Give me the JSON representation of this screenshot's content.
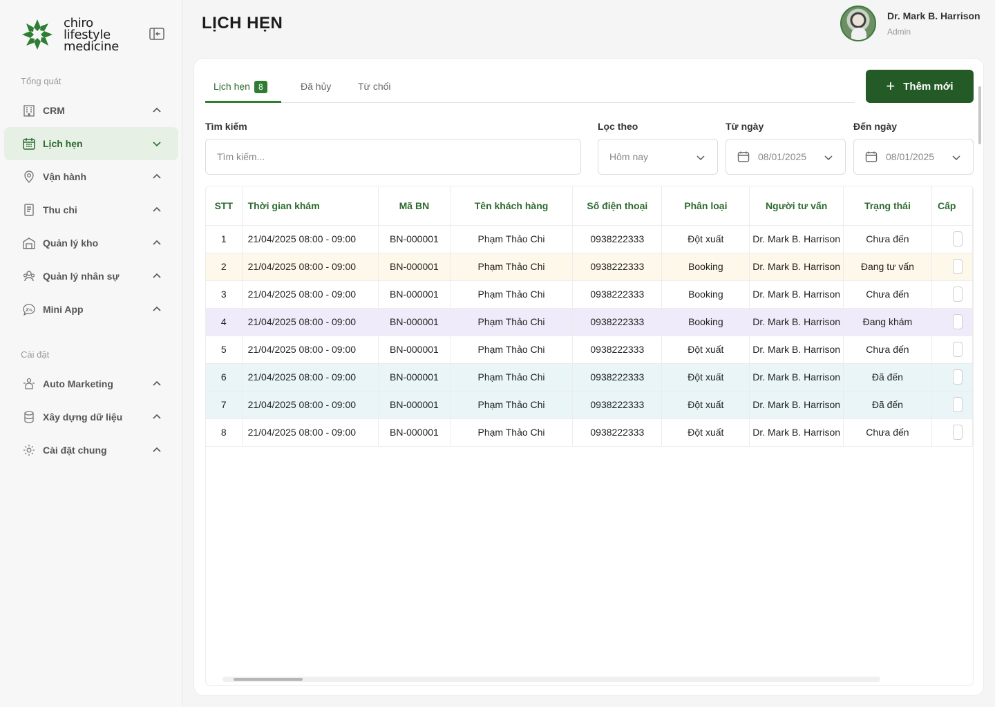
{
  "brand": {
    "logo_lines": [
      "chiro",
      "lifestyle",
      "medicine"
    ],
    "accent": "#2f7d32"
  },
  "sidebar": {
    "section_general": "Tổng quát",
    "section_settings": "Cài đặt",
    "items": [
      {
        "label": "CRM",
        "icon": "building-icon"
      },
      {
        "label": "Lịch hẹn",
        "icon": "calendar-icon",
        "active": true
      },
      {
        "label": "Vận hành",
        "icon": "location-pin-icon"
      },
      {
        "label": "Thu chi",
        "icon": "receipt-icon"
      },
      {
        "label": "Quản lý kho",
        "icon": "warehouse-icon"
      },
      {
        "label": "Quản lý nhân sự",
        "icon": "people-icon"
      },
      {
        "label": "Mini App",
        "icon": "zalo-icon"
      },
      {
        "label": "Auto Marketing",
        "icon": "marketing-icon"
      },
      {
        "label": "Xây dựng dữ liệu",
        "icon": "database-icon"
      },
      {
        "label": "Cài đặt chung",
        "icon": "settings-icon"
      }
    ]
  },
  "header": {
    "title": "LỊCH HẸN"
  },
  "user": {
    "name": "Dr. Mark B. Harrison",
    "role": "Admin"
  },
  "tabs": [
    {
      "label": "Lịch hẹn",
      "badge": "8",
      "active": true
    },
    {
      "label": "Đã hủy"
    },
    {
      "label": "Từ chối"
    }
  ],
  "add_button": "Thêm mới",
  "filters": {
    "search_label": "Tìm kiếm",
    "search_placeholder": "Tìm kiếm...",
    "filter_label": "Lọc theo",
    "filter_value": "Hôm nay",
    "from_label": "Từ ngày",
    "from_value": "08/01/2025",
    "to_label": "Đến ngày",
    "to_value": "08/01/2025"
  },
  "table": {
    "columns": [
      "STT",
      "Thời gian khám",
      "Mã BN",
      "Tên khách hàng",
      "Số điện thoại",
      "Phân loại",
      "Người tư vấn",
      "Trạng thái",
      "Cấp"
    ],
    "rows": [
      [
        "1",
        "21/04/2025 08:00 - 09:00",
        "BN-000001",
        "Phạm Thảo Chi",
        "0938222333",
        "Đột xuất",
        "Dr. Mark B. Harrison",
        "Chưa đến"
      ],
      [
        "2",
        "21/04/2025 08:00 - 09:00",
        "BN-000001",
        "Phạm Thảo Chi",
        "0938222333",
        "Booking",
        "Dr. Mark B. Harrison",
        "Đang tư vấn"
      ],
      [
        "3",
        "21/04/2025 08:00 - 09:00",
        "BN-000001",
        "Phạm Thảo Chi",
        "0938222333",
        "Booking",
        "Dr. Mark B. Harrison",
        "Chưa đến"
      ],
      [
        "4",
        "21/04/2025 08:00 - 09:00",
        "BN-000001",
        "Phạm Thảo Chi",
        "0938222333",
        "Booking",
        "Dr. Mark B. Harrison",
        "Đang khám"
      ],
      [
        "5",
        "21/04/2025 08:00 - 09:00",
        "BN-000001",
        "Phạm Thảo Chi",
        "0938222333",
        "Đột xuất",
        "Dr. Mark B. Harrison",
        "Chưa đến"
      ],
      [
        "6",
        "21/04/2025 08:00 - 09:00",
        "BN-000001",
        "Phạm Thảo Chi",
        "0938222333",
        "Đột xuất",
        "Dr. Mark B. Harrison",
        "Đã đến"
      ],
      [
        "7",
        "21/04/2025 08:00 - 09:00",
        "BN-000001",
        "Phạm Thảo Chi",
        "0938222333",
        "Đột xuất",
        "Dr. Mark B. Harrison",
        "Đã đến"
      ],
      [
        "8",
        "21/04/2025 08:00 - 09:00",
        "BN-000001",
        "Phạm Thảo Chi",
        "0938222333",
        "Đột xuất",
        "Dr. Mark B. Harrison",
        "Chưa đến"
      ]
    ],
    "row_tints": [
      "",
      "yellow",
      "",
      "purple",
      "",
      "blue",
      "blue",
      ""
    ]
  }
}
